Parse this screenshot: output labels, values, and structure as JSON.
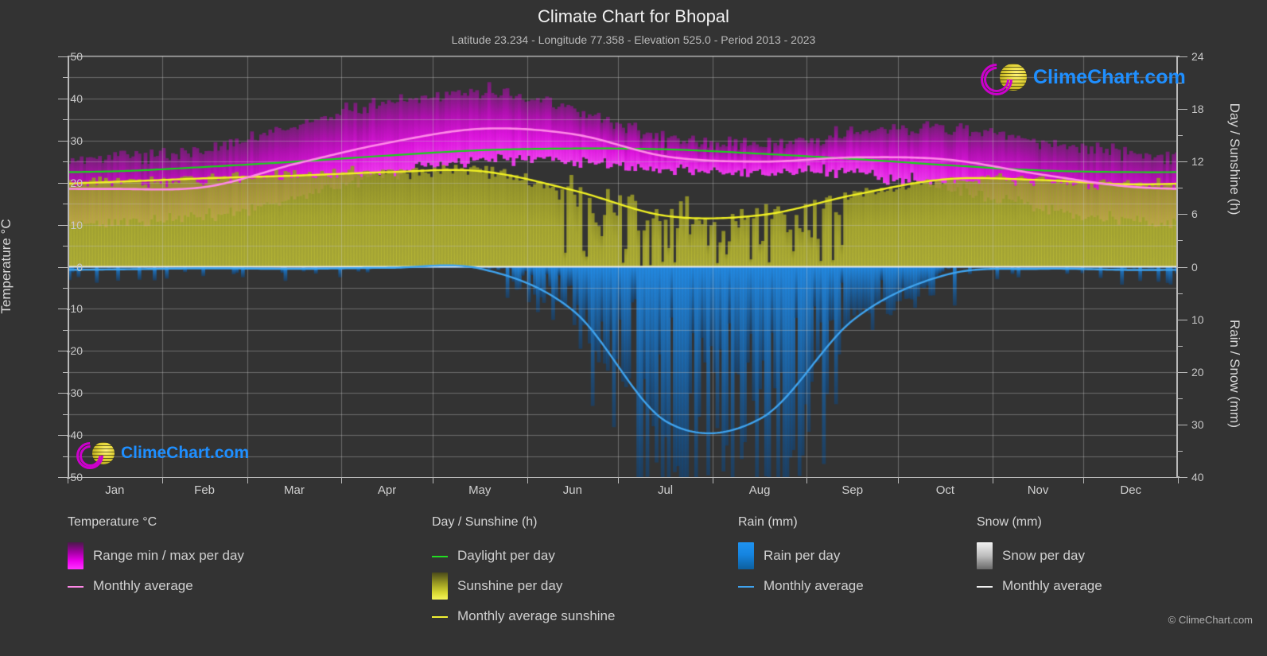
{
  "header": {
    "title": "Climate Chart for Bhopal",
    "subtitle": "Latitude 23.234 - Longitude 77.358 - Elevation 525.0 - Period 2013 - 2023"
  },
  "axes": {
    "left_title": "Temperature °C",
    "right_top_title": "Day / Sunshine (h)",
    "right_bottom_title": "Rain / Snow (mm)",
    "left_ticks": [
      "50",
      "40",
      "30",
      "20",
      "10",
      "0",
      "-10",
      "-20",
      "-30",
      "-40",
      "-50"
    ],
    "right_top_ticks": [
      "24",
      "18",
      "12",
      "6",
      "0"
    ],
    "right_bottom_ticks": [
      "0",
      "10",
      "20",
      "30",
      "40"
    ],
    "months": [
      "Jan",
      "Feb",
      "Mar",
      "Apr",
      "May",
      "Jun",
      "Jul",
      "Aug",
      "Sep",
      "Oct",
      "Nov",
      "Dec"
    ]
  },
  "legend": {
    "temperature": {
      "heading": "Temperature °C",
      "items": [
        {
          "label": "Range min / max per day",
          "type": "swatch",
          "color": "#e000e0"
        },
        {
          "label": "Monthly average",
          "type": "line",
          "color": "#ff88e8"
        }
      ]
    },
    "daysun": {
      "heading": "Day / Sunshine (h)",
      "items": [
        {
          "label": "Daylight per day",
          "type": "line",
          "color": "#22dd22"
        },
        {
          "label": "Sunshine per day",
          "type": "swatch",
          "color": "#e8e832"
        },
        {
          "label": "Monthly average sunshine",
          "type": "line",
          "color": "#f2f233"
        }
      ]
    },
    "rain": {
      "heading": "Rain (mm)",
      "items": [
        {
          "label": "Rain per day",
          "type": "swatch",
          "color": "#1088e8"
        },
        {
          "label": "Monthly average",
          "type": "line",
          "color": "#3fa3ee"
        }
      ]
    },
    "snow": {
      "heading": "Snow (mm)",
      "items": [
        {
          "label": "Snow per day",
          "type": "swatch",
          "color": "#e8e8e8"
        },
        {
          "label": "Monthly average",
          "type": "line",
          "color": "#f0f0f0"
        }
      ]
    }
  },
  "branding": {
    "logo_text": "ClimeChart.com",
    "copyright": "© ClimeChart.com"
  },
  "chart_data": {
    "type": "area",
    "title": "Climate Chart for Bhopal",
    "subtitle": "Latitude 23.234 - Longitude 77.358 - Elevation 525.0 - Period 2013 - 2023",
    "xlabel": "",
    "ylabel": "Temperature °C",
    "ylim": [
      -50,
      50
    ],
    "y2lim_top": [
      0,
      24
    ],
    "y2lim_bottom": [
      0,
      40
    ],
    "grid": true,
    "legend_position": "below",
    "categories": [
      "Jan",
      "Feb",
      "Mar",
      "Apr",
      "May",
      "Jun",
      "Jul",
      "Aug",
      "Sep",
      "Oct",
      "Nov",
      "Dec"
    ],
    "series": [
      {
        "name": "Monthly average temperature (°C)",
        "color": "#ff88e8",
        "values": [
          18.5,
          19.0,
          24.5,
          29.5,
          32.8,
          31.5,
          26.2,
          25.0,
          26.0,
          25.5,
          22.0,
          19.0
        ]
      },
      {
        "name": "Daily max temperature (°C)",
        "color": "#e000e0",
        "values": [
          26.0,
          28.0,
          34.0,
          39.0,
          41.5,
          38.5,
          31.5,
          30.0,
          32.0,
          33.0,
          30.0,
          27.0
        ]
      },
      {
        "name": "Daily min temperature (°C)",
        "color": "#e000e0",
        "values": [
          10.5,
          12.0,
          16.5,
          22.0,
          25.5,
          25.0,
          23.0,
          22.5,
          22.0,
          19.0,
          14.0,
          11.0
        ]
      },
      {
        "name": "Daylight per day (h)",
        "color": "#22dd22",
        "values": [
          10.9,
          11.4,
          12.0,
          12.7,
          13.3,
          13.5,
          13.4,
          12.9,
          12.3,
          11.6,
          11.0,
          10.8
        ]
      },
      {
        "name": "Monthly average sunshine (h)",
        "color": "#f2f233",
        "values": [
          9.7,
          10.1,
          10.4,
          10.8,
          10.9,
          8.7,
          5.8,
          5.9,
          8.2,
          10.0,
          9.9,
          9.4
        ]
      },
      {
        "name": "Monthly average rain (mm)",
        "color": "#3fa3ee",
        "values": [
          0.5,
          0.3,
          0.4,
          0.2,
          0.4,
          8.5,
          29.5,
          28.8,
          10.0,
          1.5,
          0.4,
          0.6
        ]
      },
      {
        "name": "Monthly average snow (mm)",
        "color": "#f0f0f0",
        "values": [
          0,
          0,
          0,
          0,
          0,
          0,
          0,
          0,
          0,
          0,
          0,
          0
        ]
      }
    ],
    "notes": "Magenta vertical bars show daily min/max temperature range; olive/yellow bars show sunshine hours per day (read on right 0-24h axis); blue bars below the zero line show rain per day (read on inverted right 0-40mm axis)."
  }
}
